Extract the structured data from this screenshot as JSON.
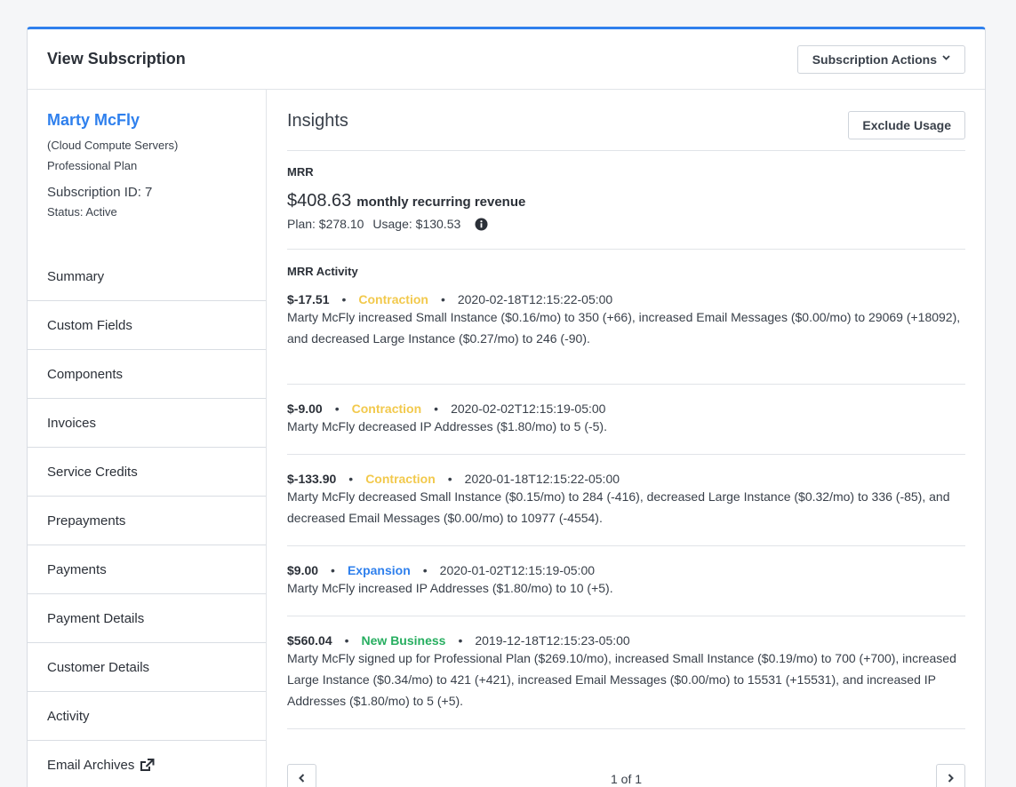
{
  "header": {
    "title": "View Subscription",
    "actions_label": "Subscription Actions"
  },
  "customer": {
    "name": "Marty McFly",
    "org": "(Cloud Compute Servers)",
    "plan": "Professional Plan",
    "subscription_id": "Subscription ID: 7",
    "status": "Status: Active"
  },
  "nav": [
    {
      "label": "Summary"
    },
    {
      "label": "Custom Fields"
    },
    {
      "label": "Components"
    },
    {
      "label": "Invoices"
    },
    {
      "label": "Service Credits"
    },
    {
      "label": "Prepayments"
    },
    {
      "label": "Payments"
    },
    {
      "label": "Payment Details"
    },
    {
      "label": "Customer Details"
    },
    {
      "label": "Activity"
    },
    {
      "label": "Email Archives",
      "icon": "external-link-icon"
    }
  ],
  "insights": {
    "title": "Insights",
    "exclude_label": "Exclude Usage",
    "mrr_label": "MRR",
    "mrr_amount": "$408.63",
    "mrr_caption": "monthly recurring revenue",
    "plan_amount": "Plan: $278.10",
    "usage_amount": "Usage: $130.53",
    "activity_label": "MRR Activity"
  },
  "activity": [
    {
      "amount": "$-17.51",
      "type": "Contraction",
      "timestamp": "2020-02-18T12:15:22-05:00",
      "description": "Marty McFly increased Small Instance ($0.16/mo) to 350 (+66), increased Email Messages ($0.00/mo) to 29069 (+18092), and decreased Large Instance ($0.27/mo) to 246 (-90)."
    },
    {
      "amount": "$-9.00",
      "type": "Contraction",
      "timestamp": "2020-02-02T12:15:19-05:00",
      "description": "Marty McFly decreased IP Addresses ($1.80/mo) to 5 (-5)."
    },
    {
      "amount": "$-133.90",
      "type": "Contraction",
      "timestamp": "2020-01-18T12:15:22-05:00",
      "description": "Marty McFly decreased Small Instance ($0.15/mo) to 284 (-416), decreased Large Instance ($0.32/mo) to 336 (-85), and decreased Email Messages ($0.00/mo) to 10977 (-4554)."
    },
    {
      "amount": "$9.00",
      "type": "Expansion",
      "timestamp": "2020-01-02T12:15:19-05:00",
      "description": "Marty McFly increased IP Addresses ($1.80/mo) to 10 (+5)."
    },
    {
      "amount": "$560.04",
      "type": "New Business",
      "timestamp": "2019-12-18T12:15:23-05:00",
      "description": "Marty McFly signed up for Professional Plan ($269.10/mo), increased Small Instance ($0.19/mo) to 700 (+700), increased Large Instance ($0.34/mo) to 421 (+421), increased Email Messages ($0.00/mo) to 15531 (+15531), and increased IP Addresses ($1.80/mo) to 5 (+5)."
    }
  ],
  "pagination": {
    "text": "1 of 1"
  },
  "colors": {
    "accent": "#2f80ed",
    "contraction": "#f2c94c",
    "expansion": "#2f80ed",
    "new_business": "#27ae60"
  }
}
